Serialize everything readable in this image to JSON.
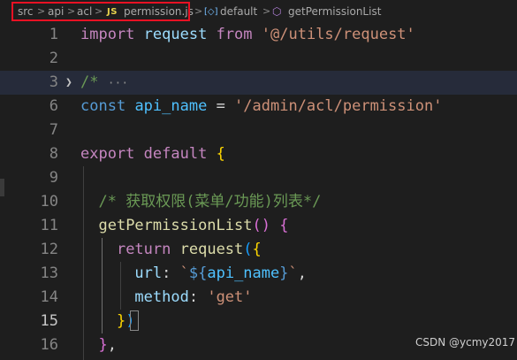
{
  "breadcrumb": {
    "src": "src",
    "api": "api",
    "acl": "acl",
    "file_badge": "JS",
    "file": "permission.js",
    "export_icon": "variable-icon",
    "default": "default",
    "method_icon": "method-cube-icon",
    "method": "getPermissionList",
    "separator": ">"
  },
  "highlight_color": "#e81123",
  "line_numbers": [
    "1",
    "2",
    "3",
    "6",
    "7",
    "8",
    "9",
    "10",
    "11",
    "12",
    "13",
    "14",
    "15",
    "16"
  ],
  "active_line": "15",
  "tokens": {
    "import": "import",
    "request": "request",
    "from": "from",
    "import_path": "'@/utils/request'",
    "folded_comment": "/*",
    "fold_ellipsis": "···",
    "const": "const",
    "api_name": "api_name",
    "eq": " = ",
    "api_path": "'/admin/acl/permission'",
    "export": "export",
    "default": "default",
    "brace_open": "{",
    "comment_cn": "/* 获取权限(菜单/功能)列表*/",
    "method_name": "getPermissionList",
    "paren_pair": "()",
    "return": "return",
    "paren_open": "(",
    "url_key": "url",
    "colon": ": ",
    "tpl_start": "`",
    "tpl_expr_open": "${",
    "tpl_expr_close": "}",
    "tpl_end": "`",
    "comma": ",",
    "method_key": "method",
    "get": "'get'",
    "brace_close": "}",
    "paren_close": ")",
    "brace_close_comma": "},"
  },
  "watermark": "CSDN @ycmy2017"
}
